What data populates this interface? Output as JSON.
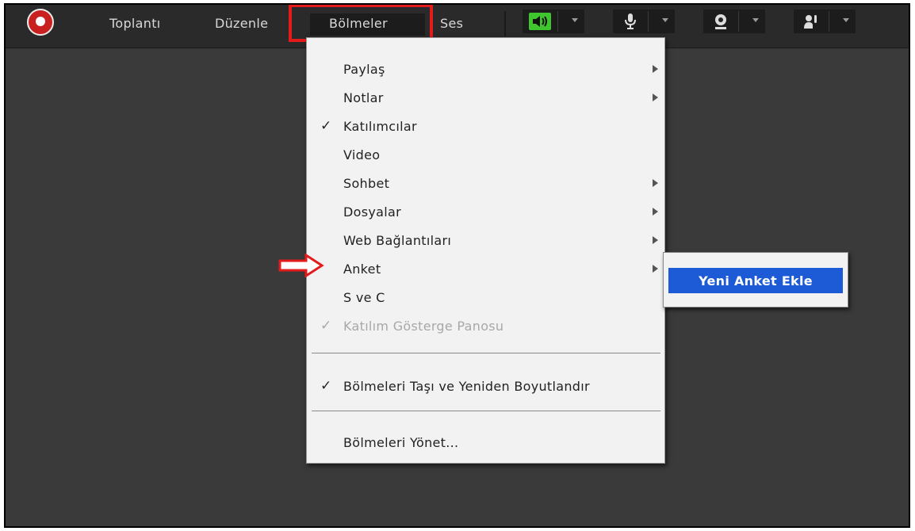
{
  "menubar": {
    "items": [
      {
        "label": "Toplantı"
      },
      {
        "label": "Düzenle"
      },
      {
        "label": "Bölmeler"
      },
      {
        "label": "Ses"
      }
    ]
  },
  "toolbar": {
    "tools": [
      {
        "icon": "speaker-icon",
        "accent": "#3fc62f"
      },
      {
        "icon": "microphone-icon"
      },
      {
        "icon": "webcam-icon"
      },
      {
        "icon": "raise-hand-icon"
      }
    ]
  },
  "dropdown": {
    "items": [
      {
        "label": "Paylaş",
        "checked": false,
        "submenu": true,
        "disabled": false
      },
      {
        "label": "Notlar",
        "checked": false,
        "submenu": true,
        "disabled": false
      },
      {
        "label": "Katılımcılar",
        "checked": true,
        "submenu": false,
        "disabled": false
      },
      {
        "label": "Video",
        "checked": false,
        "submenu": false,
        "disabled": false
      },
      {
        "label": "Sohbet",
        "checked": false,
        "submenu": true,
        "disabled": false
      },
      {
        "label": "Dosyalar",
        "checked": false,
        "submenu": true,
        "disabled": false
      },
      {
        "label": "Web Bağlantıları",
        "checked": false,
        "submenu": true,
        "disabled": false
      },
      {
        "label": "Anket",
        "checked": false,
        "submenu": true,
        "disabled": false
      },
      {
        "label": "S ve C",
        "checked": false,
        "submenu": false,
        "disabled": false
      },
      {
        "label": "Katılım Gösterge Panosu",
        "checked": true,
        "submenu": false,
        "disabled": true
      },
      {
        "label": "Bölmeleri Taşı ve Yeniden Boyutlandır",
        "checked": true,
        "submenu": false,
        "disabled": false
      },
      {
        "label": "Bölmeleri Yönet...",
        "checked": false,
        "submenu": false,
        "disabled": false
      }
    ]
  },
  "submenu": {
    "item": "Yeni Anket Ekle"
  },
  "colors": {
    "highlight": "#e31b1b",
    "selection": "#1d5bd6"
  }
}
